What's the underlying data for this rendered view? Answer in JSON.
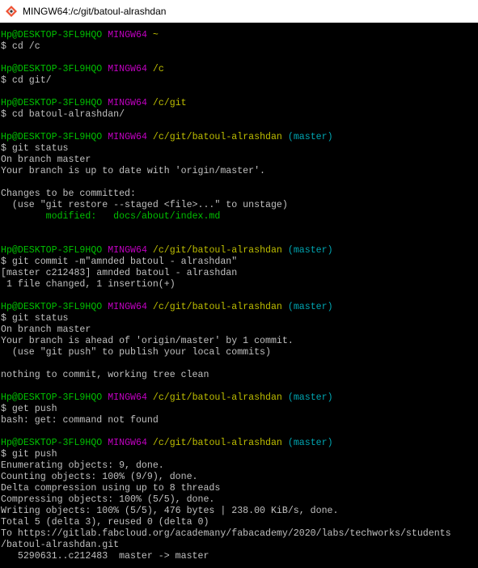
{
  "window": {
    "title": "MINGW64:/c/git/batoul-alrashdan"
  },
  "colors": {
    "user_host": "#00c000",
    "shell_name": "#c000c0",
    "path": "#bfbf00",
    "branch": "#00a6b2",
    "text": "#c0c0c0",
    "modified": "#00c000",
    "icon": "git-bash-icon"
  },
  "terminal": {
    "lines": [
      {
        "segments": [
          {
            "text": "Hp@DESKTOP-3FL9HQO",
            "role": "user_host"
          },
          {
            "text": " "
          },
          {
            "text": "MINGW64",
            "role": "shell_name"
          },
          {
            "text": " "
          },
          {
            "text": "~",
            "role": "path"
          }
        ]
      },
      {
        "segments": [
          {
            "text": "$ cd /c"
          }
        ]
      },
      {
        "segments": [
          {
            "text": ""
          }
        ]
      },
      {
        "segments": [
          {
            "text": "Hp@DESKTOP-3FL9HQO",
            "role": "user_host"
          },
          {
            "text": " "
          },
          {
            "text": "MINGW64",
            "role": "shell_name"
          },
          {
            "text": " "
          },
          {
            "text": "/c",
            "role": "path"
          }
        ]
      },
      {
        "segments": [
          {
            "text": "$ cd git/"
          }
        ]
      },
      {
        "segments": [
          {
            "text": ""
          }
        ]
      },
      {
        "segments": [
          {
            "text": "Hp@DESKTOP-3FL9HQO",
            "role": "user_host"
          },
          {
            "text": " "
          },
          {
            "text": "MINGW64",
            "role": "shell_name"
          },
          {
            "text": " "
          },
          {
            "text": "/c/git",
            "role": "path"
          }
        ]
      },
      {
        "segments": [
          {
            "text": "$ cd batoul-alrashdan/"
          }
        ]
      },
      {
        "segments": [
          {
            "text": ""
          }
        ]
      },
      {
        "segments": [
          {
            "text": "Hp@DESKTOP-3FL9HQO",
            "role": "user_host"
          },
          {
            "text": " "
          },
          {
            "text": "MINGW64",
            "role": "shell_name"
          },
          {
            "text": " "
          },
          {
            "text": "/c/git/batoul-alrashdan",
            "role": "path"
          },
          {
            "text": " "
          },
          {
            "text": "(master)",
            "role": "branch"
          }
        ]
      },
      {
        "segments": [
          {
            "text": "$ git status"
          }
        ]
      },
      {
        "segments": [
          {
            "text": "On branch master"
          }
        ]
      },
      {
        "segments": [
          {
            "text": "Your branch is up to date with 'origin/master'."
          }
        ]
      },
      {
        "segments": [
          {
            "text": ""
          }
        ]
      },
      {
        "segments": [
          {
            "text": "Changes to be committed:"
          }
        ]
      },
      {
        "segments": [
          {
            "text": "  (use \"git restore --staged <file>...\" to unstage)"
          }
        ]
      },
      {
        "segments": [
          {
            "text": "        "
          },
          {
            "text": "modified:   docs/about/index.md",
            "role": "modified"
          }
        ]
      },
      {
        "segments": [
          {
            "text": ""
          }
        ]
      },
      {
        "segments": [
          {
            "text": ""
          }
        ]
      },
      {
        "segments": [
          {
            "text": "Hp@DESKTOP-3FL9HQO",
            "role": "user_host"
          },
          {
            "text": " "
          },
          {
            "text": "MINGW64",
            "role": "shell_name"
          },
          {
            "text": " "
          },
          {
            "text": "/c/git/batoul-alrashdan",
            "role": "path"
          },
          {
            "text": " "
          },
          {
            "text": "(master)",
            "role": "branch"
          }
        ]
      },
      {
        "segments": [
          {
            "text": "$ git commit -m\"amnded batoul - alrashdan\""
          }
        ]
      },
      {
        "segments": [
          {
            "text": "[master c212483] amnded batoul - alrashdan"
          }
        ]
      },
      {
        "segments": [
          {
            "text": " 1 file changed, 1 insertion(+)"
          }
        ]
      },
      {
        "segments": [
          {
            "text": ""
          }
        ]
      },
      {
        "segments": [
          {
            "text": "Hp@DESKTOP-3FL9HQO",
            "role": "user_host"
          },
          {
            "text": " "
          },
          {
            "text": "MINGW64",
            "role": "shell_name"
          },
          {
            "text": " "
          },
          {
            "text": "/c/git/batoul-alrashdan",
            "role": "path"
          },
          {
            "text": " "
          },
          {
            "text": "(master)",
            "role": "branch"
          }
        ]
      },
      {
        "segments": [
          {
            "text": "$ git status"
          }
        ]
      },
      {
        "segments": [
          {
            "text": "On branch master"
          }
        ]
      },
      {
        "segments": [
          {
            "text": "Your branch is ahead of 'origin/master' by 1 commit."
          }
        ]
      },
      {
        "segments": [
          {
            "text": "  (use \"git push\" to publish your local commits)"
          }
        ]
      },
      {
        "segments": [
          {
            "text": ""
          }
        ]
      },
      {
        "segments": [
          {
            "text": "nothing to commit, working tree clean"
          }
        ]
      },
      {
        "segments": [
          {
            "text": ""
          }
        ]
      },
      {
        "segments": [
          {
            "text": "Hp@DESKTOP-3FL9HQO",
            "role": "user_host"
          },
          {
            "text": " "
          },
          {
            "text": "MINGW64",
            "role": "shell_name"
          },
          {
            "text": " "
          },
          {
            "text": "/c/git/batoul-alrashdan",
            "role": "path"
          },
          {
            "text": " "
          },
          {
            "text": "(master)",
            "role": "branch"
          }
        ]
      },
      {
        "segments": [
          {
            "text": "$ get push"
          }
        ]
      },
      {
        "segments": [
          {
            "text": "bash: get: command not found"
          }
        ]
      },
      {
        "segments": [
          {
            "text": ""
          }
        ]
      },
      {
        "segments": [
          {
            "text": "Hp@DESKTOP-3FL9HQO",
            "role": "user_host"
          },
          {
            "text": " "
          },
          {
            "text": "MINGW64",
            "role": "shell_name"
          },
          {
            "text": " "
          },
          {
            "text": "/c/git/batoul-alrashdan",
            "role": "path"
          },
          {
            "text": " "
          },
          {
            "text": "(master)",
            "role": "branch"
          }
        ]
      },
      {
        "segments": [
          {
            "text": "$ git push"
          }
        ]
      },
      {
        "segments": [
          {
            "text": "Enumerating objects: 9, done."
          }
        ]
      },
      {
        "segments": [
          {
            "text": "Counting objects: 100% (9/9), done."
          }
        ]
      },
      {
        "segments": [
          {
            "text": "Delta compression using up to 8 threads"
          }
        ]
      },
      {
        "segments": [
          {
            "text": "Compressing objects: 100% (5/5), done."
          }
        ]
      },
      {
        "segments": [
          {
            "text": "Writing objects: 100% (5/5), 476 bytes | 238.00 KiB/s, done."
          }
        ]
      },
      {
        "segments": [
          {
            "text": "Total 5 (delta 3), reused 0 (delta 0)"
          }
        ]
      },
      {
        "segments": [
          {
            "text": "To https://gitlab.fabcloud.org/academany/fabacademy/2020/labs/techworks/students"
          }
        ]
      },
      {
        "segments": [
          {
            "text": "/batoul-alrashdan.git"
          }
        ]
      },
      {
        "segments": [
          {
            "text": "   5290631..c212483  master -> master"
          }
        ]
      }
    ]
  }
}
